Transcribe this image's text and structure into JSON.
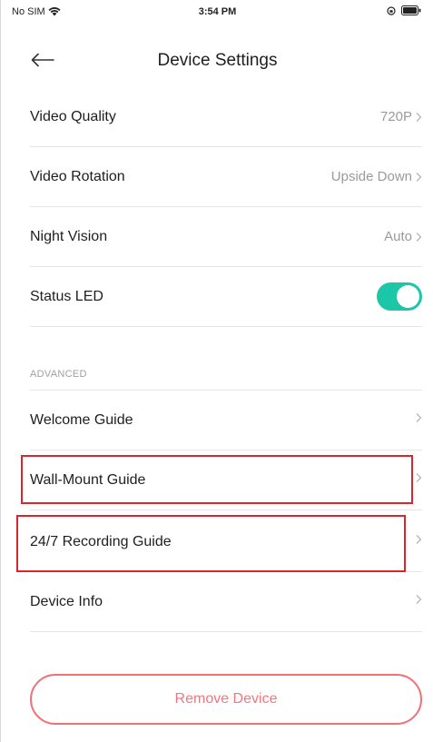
{
  "status_bar": {
    "carrier": "No SIM",
    "time": "3:54 PM"
  },
  "header": {
    "title": "Device Settings"
  },
  "settings": {
    "video_quality": {
      "label": "Video Quality",
      "value": "720P"
    },
    "video_rotation": {
      "label": "Video Rotation",
      "value": "Upside Down"
    },
    "night_vision": {
      "label": "Night Vision",
      "value": "Auto"
    },
    "status_led": {
      "label": "Status LED",
      "enabled": true
    }
  },
  "advanced": {
    "section_label": "ADVANCED",
    "welcome_guide": {
      "label": "Welcome Guide"
    },
    "wall_mount_guide": {
      "label": "Wall-Mount Guide"
    },
    "recording_guide": {
      "label": "24/7 Recording Guide"
    },
    "device_info": {
      "label": "Device Info"
    }
  },
  "remove_button": {
    "label": "Remove Device"
  },
  "colors": {
    "toggle_on": "#1cc6a8",
    "remove_accent": "#f36f76",
    "highlight": "#d8262b"
  }
}
